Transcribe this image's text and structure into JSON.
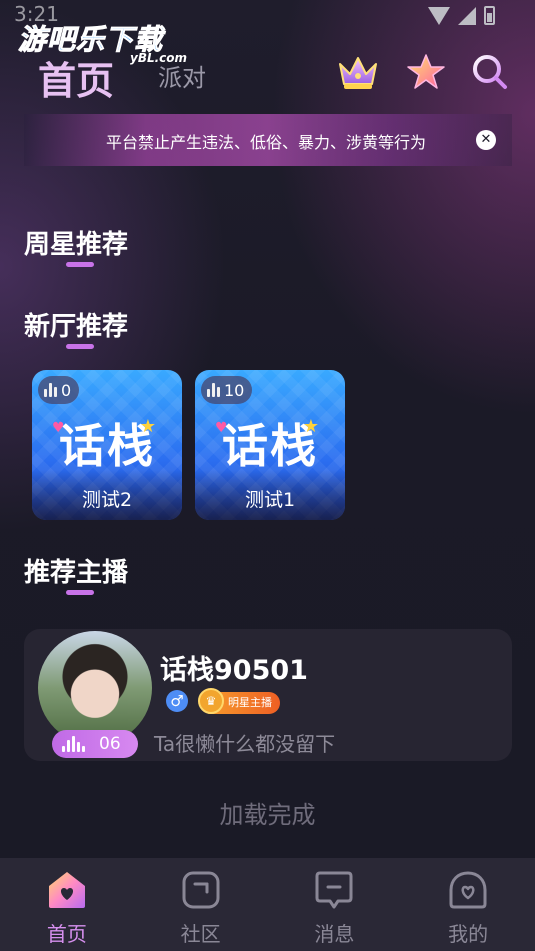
{
  "status_bar": {
    "time": "3:21"
  },
  "watermark": {
    "title": "游吧乐下载",
    "sub": "yBL.com"
  },
  "header": {
    "tabs": [
      {
        "label": "首页",
        "active": true
      },
      {
        "label": "派对",
        "active": false
      }
    ],
    "icons": [
      "crown-icon",
      "star-icon",
      "search-icon"
    ]
  },
  "notice": {
    "text": "平台禁止产生违法、低俗、暴力、涉黄等行为",
    "close_icon": "close-icon"
  },
  "sections": {
    "weekly_star": "周星推荐",
    "new_rooms": "新厅推荐",
    "recommended_hosts": "推荐主播"
  },
  "rooms": [
    {
      "name": "测试2",
      "count": "0",
      "logo": "话栈"
    },
    {
      "name": "测试1",
      "count": "10",
      "logo": "话栈"
    }
  ],
  "host": {
    "name": "话栈90501",
    "gender": "♂",
    "badge": "明星主播",
    "bio": "Ta很懒什么都没留下",
    "wave_count": "06"
  },
  "load_status": "加载完成",
  "bottom_nav": [
    {
      "label": "首页",
      "icon": "home-icon",
      "active": true
    },
    {
      "label": "社区",
      "icon": "community-icon",
      "active": false
    },
    {
      "label": "消息",
      "icon": "message-icon",
      "active": false
    },
    {
      "label": "我的",
      "icon": "profile-icon",
      "active": false
    }
  ],
  "colors": {
    "accent": "#c873e8",
    "background": "#1b1a27",
    "card": "#272532",
    "nav_bg": "#2a2836"
  }
}
